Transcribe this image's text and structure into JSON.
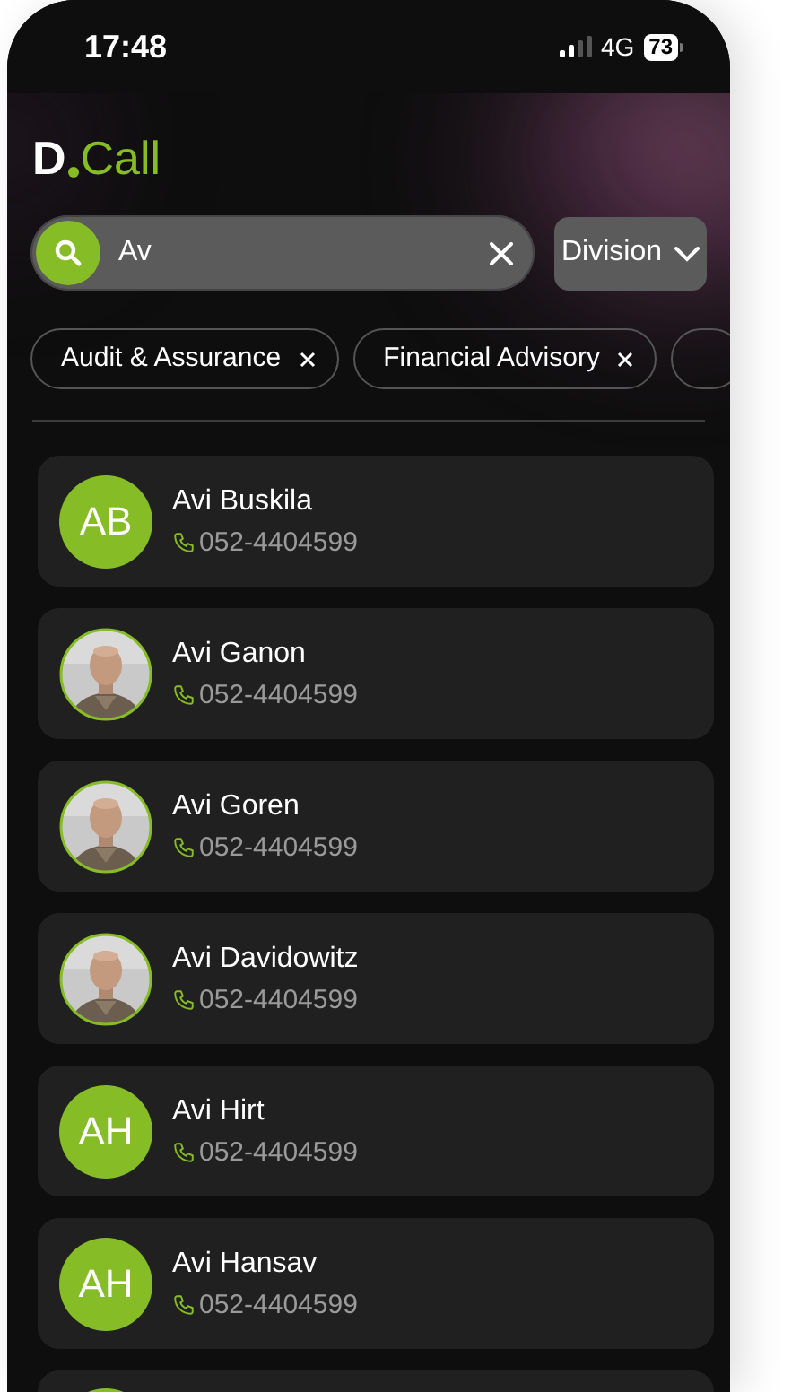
{
  "status_bar": {
    "time": "17:48",
    "network": "4G",
    "battery": "73"
  },
  "logo": {
    "mark": "D",
    "name": "Call"
  },
  "search": {
    "value": "Av"
  },
  "filter_button": {
    "label": "Division"
  },
  "chips": [
    {
      "label": "Audit & Assurance"
    },
    {
      "label": "Financial Advisory"
    }
  ],
  "contacts": [
    {
      "name": "Avi Buskila",
      "phone": "052-4404599",
      "kind": "initials",
      "initials": "AB"
    },
    {
      "name": "Avi Ganon",
      "phone": "052-4404599"
    },
    {
      "name": "Avi Goren",
      "phone": "052-4404599"
    },
    {
      "name": "Avi Davidowitz",
      "phone": "052-4404599"
    },
    {
      "name": "Avi Hirt",
      "phone": "052-4404599",
      "kind": "initials",
      "initials": "AH"
    },
    {
      "name": "Avi Hansav",
      "phone": "052-4404599",
      "kind": "initials",
      "initials": "AH"
    }
  ]
}
